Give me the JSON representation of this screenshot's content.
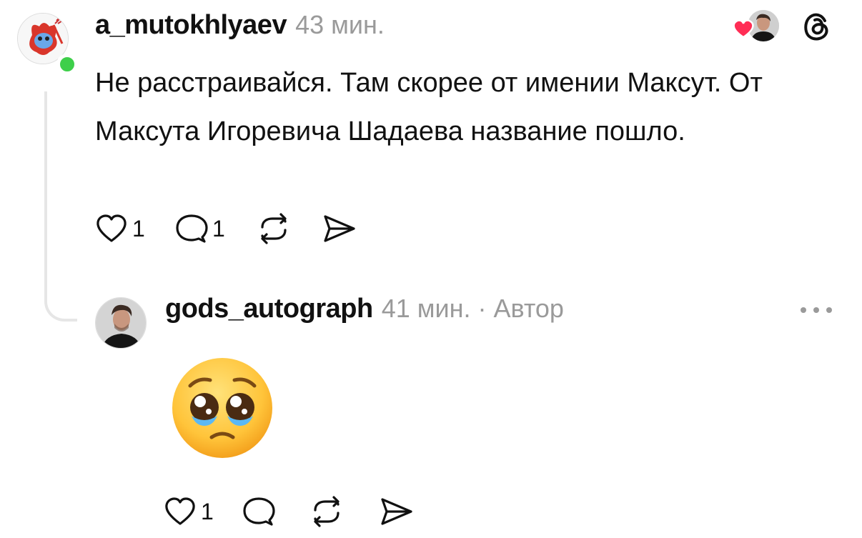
{
  "comments": [
    {
      "username": "a_mutokhlyaev",
      "time": "43 мин.",
      "text": "Не расстраивайся. Там скорее от имении Максут. От Максута Игоревича Шадаева название пошло.",
      "likes": "1",
      "replies": "1"
    },
    {
      "username": "gods_autograph",
      "time": "41 мин.",
      "author_tag": "· Автор",
      "likes": "1"
    }
  ],
  "icons": {
    "like": "heart-outline-icon",
    "reply": "speech-bubble-icon",
    "repost": "repost-arrows-icon",
    "share": "send-icon",
    "more": "more-dots-icon",
    "brand": "threads-logo-icon"
  },
  "colors": {
    "online": "#3ecf4a",
    "liked_heart": "#ff2d55",
    "meta_text": "#9a9a9a",
    "thread_line": "#e6e6e6"
  }
}
